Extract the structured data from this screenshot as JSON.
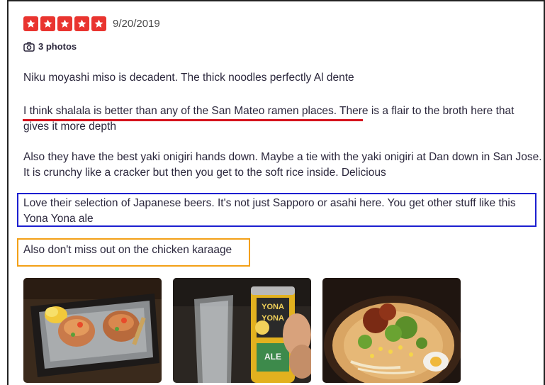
{
  "review": {
    "rating": 5,
    "rating_max": 5,
    "date": "9/20/2019",
    "photos_label": "3 photos",
    "paragraphs": [
      "Niku moyashi miso is decadent. The thick noodles perfectly Al dente",
      "I think shalala is better than any of the San Mateo ramen places.  There is a flair to the broth here that gives it more depth",
      "Also they have the best yaki onigiri hands down. Maybe a tie with the yaki onigiri at Dan down in San Jose.  It is crunchy like a cracker but then you get to the soft rice inside. Delicious",
      "Love their selection of Japanese beers.  It's not just Sapporo or asahi here.  You get other stuff like this Yona Yona ale",
      "Also don't miss out on the chicken karaage"
    ],
    "photo_can_text": [
      "YONA",
      "YONA",
      "ALE"
    ]
  },
  "colors": {
    "star": "#e9342f",
    "underline": "#d5121d",
    "blue_box": "#1c1fd0",
    "orange_box": "#f3a017"
  },
  "icons": {
    "star": "star-icon",
    "camera": "camera-icon"
  }
}
